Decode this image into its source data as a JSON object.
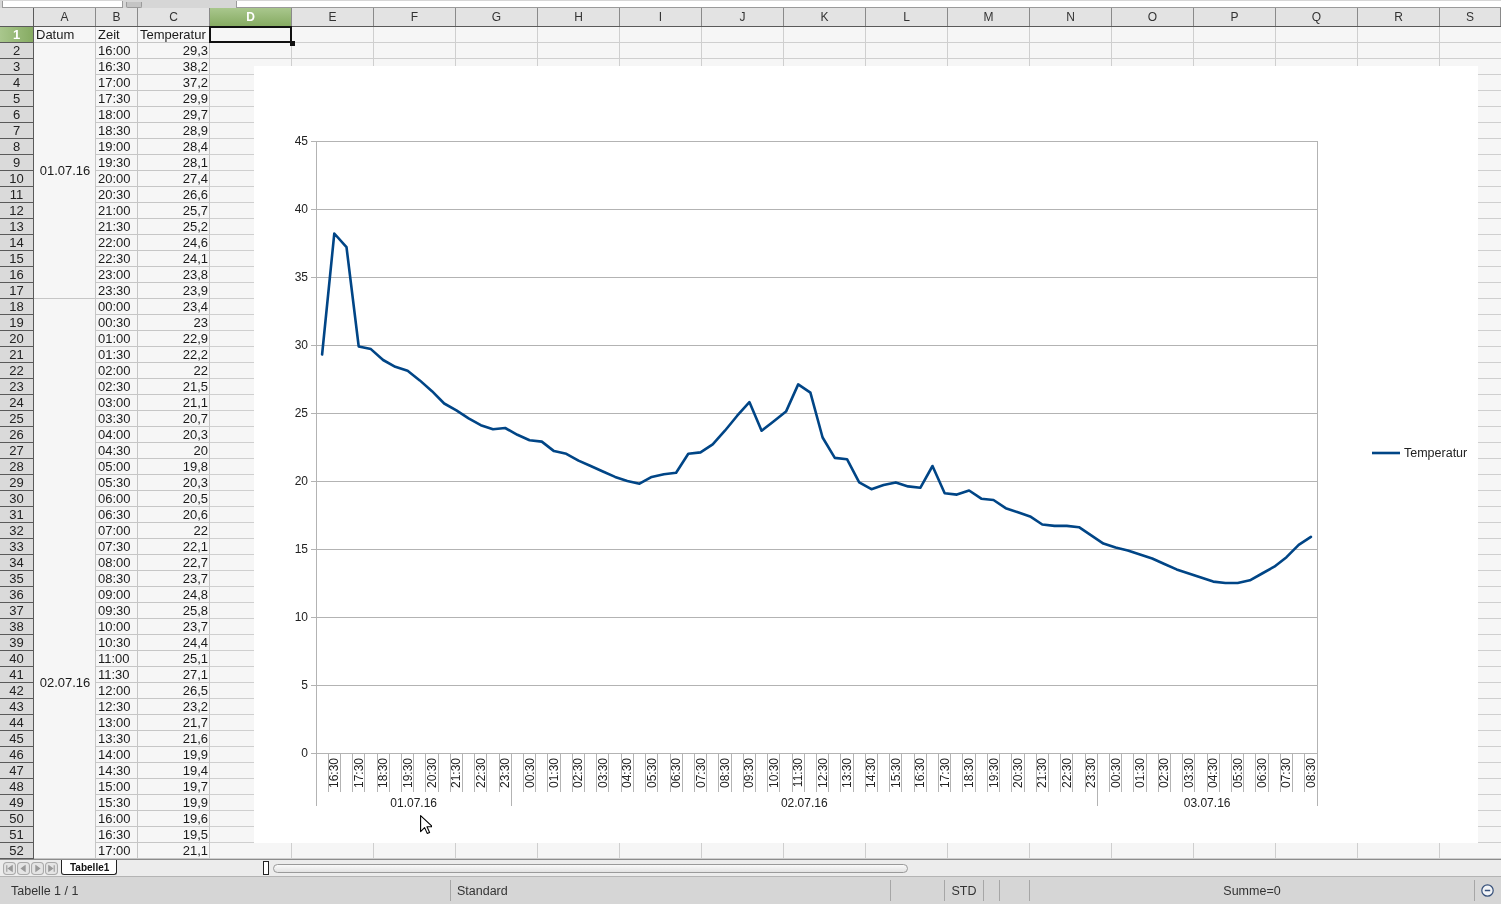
{
  "sheet": {
    "columns": [
      {
        "label": "A",
        "selected": false
      },
      {
        "label": "B",
        "selected": false
      },
      {
        "label": "C",
        "selected": false
      },
      {
        "label": "D",
        "selected": true
      },
      {
        "label": "E",
        "selected": false
      },
      {
        "label": "F",
        "selected": false
      },
      {
        "label": "G",
        "selected": false
      },
      {
        "label": "H",
        "selected": false
      },
      {
        "label": "I",
        "selected": false
      },
      {
        "label": "J",
        "selected": false
      },
      {
        "label": "K",
        "selected": false
      },
      {
        "label": "L",
        "selected": false
      },
      {
        "label": "M",
        "selected": false
      },
      {
        "label": "N",
        "selected": false
      },
      {
        "label": "O",
        "selected": false
      },
      {
        "label": "P",
        "selected": false
      },
      {
        "label": "Q",
        "selected": false
      },
      {
        "label": "R",
        "selected": false
      },
      {
        "label": "S",
        "selected": false
      }
    ],
    "rows": [
      {
        "label": "1",
        "selected": true
      },
      {
        "label": "2",
        "selected": false
      },
      {
        "label": "3",
        "selected": false
      },
      {
        "label": "4",
        "selected": false
      },
      {
        "label": "5",
        "selected": false
      },
      {
        "label": "6",
        "selected": false
      },
      {
        "label": "7",
        "selected": false
      },
      {
        "label": "8",
        "selected": false
      },
      {
        "label": "9",
        "selected": false
      },
      {
        "label": "10",
        "selected": false
      },
      {
        "label": "11",
        "selected": false
      },
      {
        "label": "12",
        "selected": false
      },
      {
        "label": "13",
        "selected": false
      },
      {
        "label": "14",
        "selected": false
      },
      {
        "label": "15",
        "selected": false
      },
      {
        "label": "16",
        "selected": false
      },
      {
        "label": "17",
        "selected": false
      },
      {
        "label": "18",
        "selected": false
      },
      {
        "label": "19",
        "selected": false
      },
      {
        "label": "20",
        "selected": false
      },
      {
        "label": "21",
        "selected": false
      },
      {
        "label": "22",
        "selected": false
      },
      {
        "label": "23",
        "selected": false
      },
      {
        "label": "24",
        "selected": false
      },
      {
        "label": "25",
        "selected": false
      },
      {
        "label": "26",
        "selected": false
      },
      {
        "label": "27",
        "selected": false
      },
      {
        "label": "28",
        "selected": false
      },
      {
        "label": "29",
        "selected": false
      },
      {
        "label": "30",
        "selected": false
      },
      {
        "label": "31",
        "selected": false
      },
      {
        "label": "32",
        "selected": false
      },
      {
        "label": "33",
        "selected": false
      },
      {
        "label": "34",
        "selected": false
      },
      {
        "label": "35",
        "selected": false
      },
      {
        "label": "36",
        "selected": false
      },
      {
        "label": "37",
        "selected": false
      },
      {
        "label": "38",
        "selected": false
      },
      {
        "label": "39",
        "selected": false
      },
      {
        "label": "40",
        "selected": false
      },
      {
        "label": "41",
        "selected": false
      },
      {
        "label": "42",
        "selected": false
      },
      {
        "label": "43",
        "selected": false
      },
      {
        "label": "44",
        "selected": false
      },
      {
        "label": "45",
        "selected": false
      },
      {
        "label": "46",
        "selected": false
      },
      {
        "label": "47",
        "selected": false
      },
      {
        "label": "48",
        "selected": false
      },
      {
        "label": "49",
        "selected": false
      },
      {
        "label": "50",
        "selected": false
      },
      {
        "label": "51",
        "selected": false
      },
      {
        "label": "52",
        "selected": false
      }
    ],
    "header_cells": [
      "Datum",
      "Zeit",
      "Temperatur"
    ],
    "date_groups": [
      {
        "date": "01.07.16",
        "continues_below": false,
        "entries": [
          {
            "time": "16:00",
            "value": "29,3"
          },
          {
            "time": "16:30",
            "value": "38,2"
          },
          {
            "time": "17:00",
            "value": "37,2"
          },
          {
            "time": "17:30",
            "value": "29,9"
          },
          {
            "time": "18:00",
            "value": "29,7"
          },
          {
            "time": "18:30",
            "value": "28,9"
          },
          {
            "time": "19:00",
            "value": "28,4"
          },
          {
            "time": "19:30",
            "value": "28,1"
          },
          {
            "time": "20:00",
            "value": "27,4"
          },
          {
            "time": "20:30",
            "value": "26,6"
          },
          {
            "time": "21:00",
            "value": "25,7"
          },
          {
            "time": "21:30",
            "value": "25,2"
          },
          {
            "time": "22:00",
            "value": "24,6"
          },
          {
            "time": "22:30",
            "value": "24,1"
          },
          {
            "time": "23:00",
            "value": "23,8"
          },
          {
            "time": "23:30",
            "value": "23,9"
          }
        ]
      },
      {
        "date": "02.07.16",
        "continues_below": true,
        "entries": [
          {
            "time": "00:00",
            "value": "23,4"
          },
          {
            "time": "00:30",
            "value": "23"
          },
          {
            "time": "01:00",
            "value": "22,9"
          },
          {
            "time": "01:30",
            "value": "22,2"
          },
          {
            "time": "02:00",
            "value": "22"
          },
          {
            "time": "02:30",
            "value": "21,5"
          },
          {
            "time": "03:00",
            "value": "21,1"
          },
          {
            "time": "03:30",
            "value": "20,7"
          },
          {
            "time": "04:00",
            "value": "20,3"
          },
          {
            "time": "04:30",
            "value": "20"
          },
          {
            "time": "05:00",
            "value": "19,8"
          },
          {
            "time": "05:30",
            "value": "20,3"
          },
          {
            "time": "06:00",
            "value": "20,5"
          },
          {
            "time": "06:30",
            "value": "20,6"
          },
          {
            "time": "07:00",
            "value": "22"
          },
          {
            "time": "07:30",
            "value": "22,1"
          },
          {
            "time": "08:00",
            "value": "22,7"
          },
          {
            "time": "08:30",
            "value": "23,7"
          },
          {
            "time": "09:00",
            "value": "24,8"
          },
          {
            "time": "09:30",
            "value": "25,8"
          },
          {
            "time": "10:00",
            "value": "23,7"
          },
          {
            "time": "10:30",
            "value": "24,4"
          },
          {
            "time": "11:00",
            "value": "25,1"
          },
          {
            "time": "11:30",
            "value": "27,1"
          },
          {
            "time": "12:00",
            "value": "26,5"
          },
          {
            "time": "12:30",
            "value": "23,2"
          },
          {
            "time": "13:00",
            "value": "21,7"
          },
          {
            "time": "13:30",
            "value": "21,6"
          },
          {
            "time": "14:00",
            "value": "19,9"
          },
          {
            "time": "14:30",
            "value": "19,4"
          },
          {
            "time": "15:00",
            "value": "19,7"
          },
          {
            "time": "15:30",
            "value": "19,9"
          },
          {
            "time": "16:00",
            "value": "19,6"
          },
          {
            "time": "16:30",
            "value": "19,5"
          },
          {
            "time": "17:00",
            "value": "21,1"
          }
        ]
      }
    ],
    "chart": {
      "chart_data": {
        "type": "line",
        "categories": [
          null,
          "16:30",
          null,
          "17:30",
          null,
          "18:30",
          null,
          "19:30",
          null,
          "20:30",
          null,
          "21:30",
          null,
          "22:30",
          null,
          "23:30",
          null,
          "00:30",
          null,
          "01:30",
          null,
          "02:30",
          null,
          "03:30",
          null,
          "04:30",
          null,
          "05:30",
          null,
          "06:30",
          null,
          "07:30",
          null,
          "08:30",
          null,
          "09:30",
          null,
          "10:30",
          null,
          "11:30",
          null,
          "12:30",
          null,
          "13:30",
          null,
          "14:30",
          null,
          "15:30",
          null,
          "16:30",
          null,
          "17:30",
          null,
          "18:30",
          null,
          "19:30",
          null,
          "20:30",
          null,
          "21:30",
          null,
          "22:30",
          null,
          "23:30",
          null,
          "00:30",
          null,
          "01:30",
          null,
          "02:30",
          null,
          "03:30",
          null,
          "04:30",
          null,
          "05:30",
          null,
          "06:30",
          null,
          "07:30",
          null,
          "08:30"
        ],
        "series": [
          {
            "name": "Temperatur",
            "color": "#004586",
            "values": [
              29.3,
              38.2,
              37.2,
              29.9,
              29.7,
              28.9,
              28.4,
              28.1,
              27.4,
              26.6,
              25.7,
              25.2,
              24.6,
              24.1,
              23.8,
              23.9,
              23.4,
              23,
              22.9,
              22.2,
              22,
              21.5,
              21.1,
              20.7,
              20.3,
              20,
              19.8,
              20.3,
              20.5,
              20.6,
              22,
              22.1,
              22.7,
              23.7,
              24.8,
              25.8,
              23.7,
              24.4,
              25.1,
              27.1,
              26.5,
              23.2,
              21.7,
              21.6,
              19.9,
              19.4,
              19.7,
              19.9,
              19.6,
              19.5,
              21.1,
              19.1,
              19.0,
              19.3,
              18.7,
              18.6,
              18.0,
              17.7,
              17.4,
              16.8,
              16.7,
              16.7,
              16.6,
              16.0,
              15.4,
              15.1,
              14.9,
              14.6,
              14.3,
              13.9,
              13.5,
              13.2,
              12.9,
              12.6,
              12.5,
              12.5,
              12.7,
              13.2,
              13.7,
              14.4,
              15.3,
              15.9
            ]
          }
        ],
        "ylim": [
          0,
          45
        ],
        "yticks": [
          0,
          5,
          10,
          15,
          20,
          25,
          30,
          35,
          40,
          45
        ],
        "grid": true
      },
      "date_labels": [
        "01.07.16",
        "02.07.16",
        "03.07.16"
      ]
    }
  },
  "sheet_tabs": [
    {
      "label": "Tabelle1",
      "selected": true
    }
  ],
  "status_bar": {
    "sheet_position": "Tabelle 1 / 1",
    "page_style": "Standard",
    "selection_mode": "STD",
    "sum": "Summe=0"
  }
}
